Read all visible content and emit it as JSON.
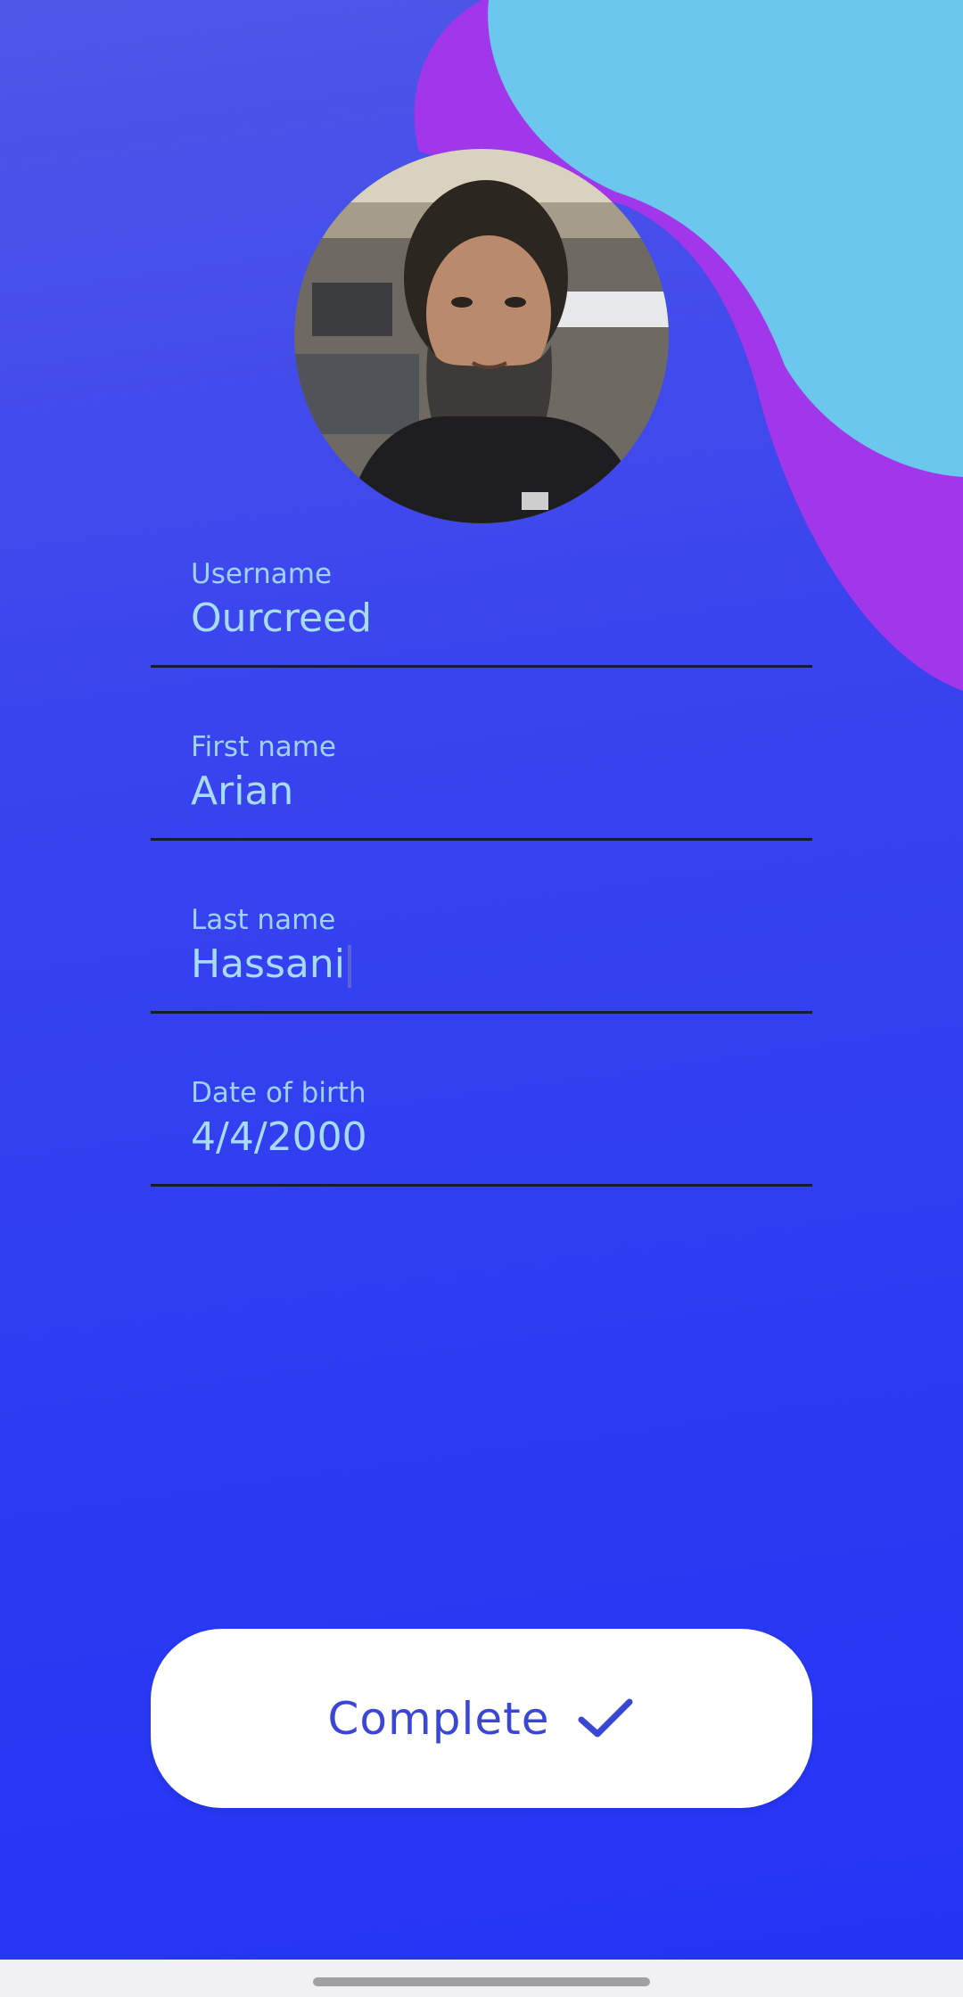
{
  "profile": {
    "avatar_alt": "Profile photo"
  },
  "form": {
    "fields": [
      {
        "label": "Username",
        "value": "Ourcreed"
      },
      {
        "label": "First name",
        "value": "Arian"
      },
      {
        "label": "Last name",
        "value": "Hassani"
      },
      {
        "label": "Date of birth",
        "value": "4/4/2000"
      }
    ]
  },
  "actions": {
    "complete_label": "Complete",
    "complete_icon": "check-icon"
  },
  "colors": {
    "background_top": "#4e57e8",
    "background_bottom": "#2434f5",
    "blob_purple": "#a236ea",
    "blob_cyan": "#6bc8ec",
    "field_text": "#a7dcf8",
    "button_text": "#3a47d6"
  }
}
